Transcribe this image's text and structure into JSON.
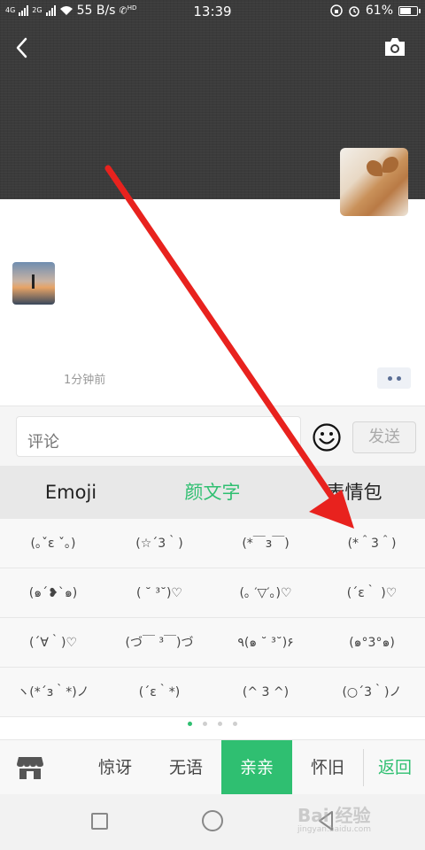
{
  "status_bar": {
    "network_left": "4G",
    "network_right": "2G",
    "speed": "55 B/s",
    "hd_badge": "HD",
    "time": "13:39",
    "battery": "61%",
    "icons": [
      "signal-icon",
      "wifi-icon",
      "call-hd-icon",
      "lock-rotation-icon",
      "alarm-icon",
      "battery-icon"
    ]
  },
  "header": {
    "icons": [
      "back-icon",
      "camera-icon"
    ]
  },
  "post": {
    "time": "1分钟前"
  },
  "comment_bar": {
    "placeholder": "评论",
    "send_label": "发送"
  },
  "category_tabs": [
    "Emoji",
    "颜文字",
    "表情包"
  ],
  "kaomoji_rows": [
    [
      "(｡ˇε ˇ｡)",
      "(☆´3｀)",
      "(*￣з￣)",
      "(*＾3＾)"
    ],
    [
      "(๑´❥`๑)",
      "( ˘ ³˘)♡",
      "(｡ ′▽′｡)♡",
      "(´ε｀ )♡"
    ],
    [
      "(´∀｀)♡",
      "(づ￣ ³￣)づ",
      "٩(๑ ˘ ³˘)۶",
      "(๑°3°๑)"
    ],
    [
      "ヽ(*´з｀*)ノ",
      "(´ε｀*)",
      "(^ 3 ^)",
      "(○´3｀)ノ"
    ]
  ],
  "pager": {
    "pages": 4,
    "current": 1
  },
  "bottom_bar": {
    "items": [
      "惊讶",
      "无语",
      "亲亲",
      "怀旧"
    ],
    "active": "亲亲",
    "back_label": "返回"
  },
  "watermark": {
    "brand": "Bai 经验",
    "url": "jingyan.baidu.com"
  },
  "colors": {
    "accent": "#2fbf71",
    "arrow": "#e8221e",
    "cover": "#3b3b3b"
  }
}
